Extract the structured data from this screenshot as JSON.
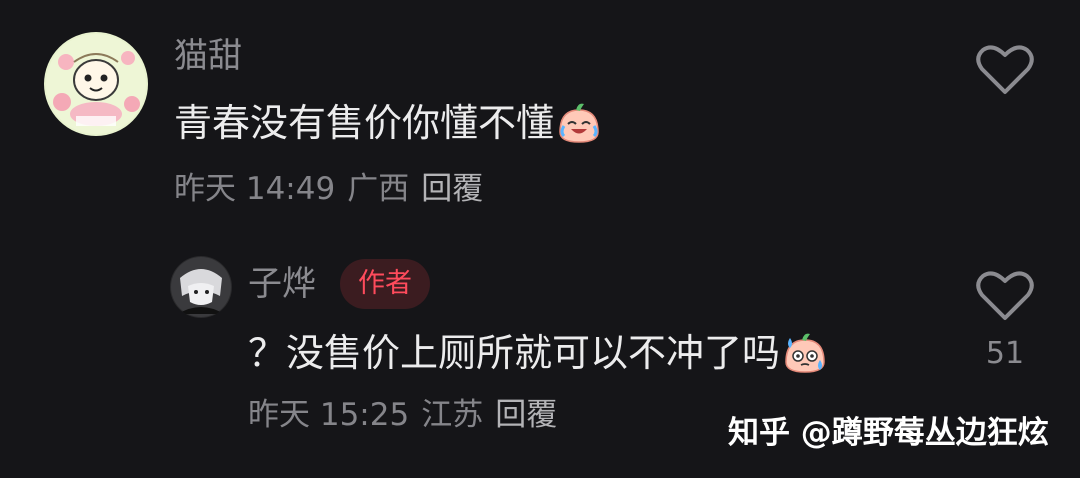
{
  "comments": [
    {
      "username": "猫甜",
      "text": "青春没有售价你懂不懂",
      "emoji": "crying-laughing-peach-emoji",
      "time": "昨天 14:49",
      "location": "广西",
      "reply_label": "回覆",
      "like_icon": "heart-outline-icon",
      "like_count": ""
    },
    {
      "username": "子烨",
      "badge": "作者",
      "text": "？没售价上厕所就可以不冲了吗",
      "emoji": "sweat-peach-emoji",
      "time": "昨天 15:25",
      "location": "江苏",
      "reply_label": "回覆",
      "like_icon": "heart-outline-icon",
      "like_count": "51"
    }
  ],
  "watermark": "知乎 @蹲野莓丛边狂炫",
  "colors": {
    "background": "#151518",
    "badge_text": "#ff4b5c",
    "badge_bg": "#3b1c20"
  }
}
